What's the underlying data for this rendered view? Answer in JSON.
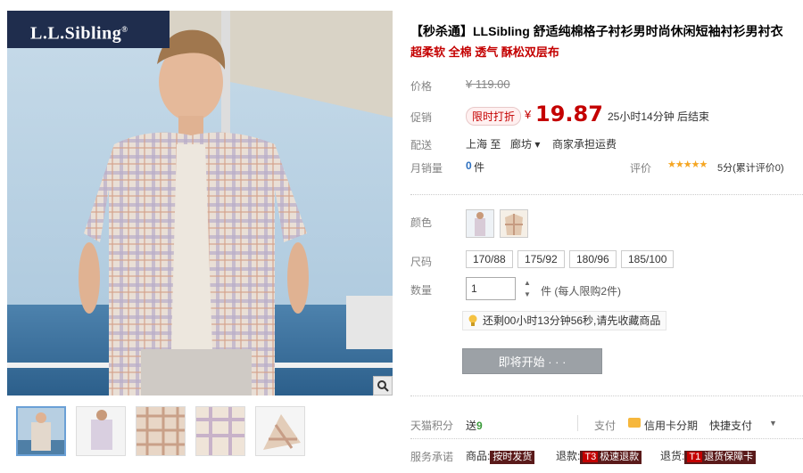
{
  "brand": {
    "logo_text": "L.L.Sibling",
    "reg_mark": "®"
  },
  "gallery": {
    "thumb_count": 5,
    "active_index": 0
  },
  "product": {
    "title": "【秒杀通】LLSibling 舒适纯棉格子衬衫男时尚休闲短袖衬衫男衬衣",
    "subtitle": "超柔软 全棉 透气 酥松双层布"
  },
  "price": {
    "label": "价格",
    "original": "¥ 119.00",
    "promo_label": "促销",
    "promo_tag": "限时打折",
    "currency": "¥",
    "current": "19.87",
    "countdown": "25小时14分钟 后结束"
  },
  "shipping": {
    "label": "配送",
    "from": "上海  至",
    "to": "廊坊 ▾",
    "fee": "商家承担运费"
  },
  "sales": {
    "label": "月销量",
    "count": "0",
    "unit": "件"
  },
  "rating": {
    "label": "评价",
    "stars": "★★★★★",
    "text": "5分(累计评价0)"
  },
  "color": {
    "label": "颜色"
  },
  "size": {
    "label": "尺码",
    "options": [
      "170/88",
      "175/92",
      "180/96",
      "185/100"
    ]
  },
  "quantity": {
    "label": "数量",
    "value": "1",
    "note": "件 (每人限购2件)"
  },
  "reminder": "还剩00小时13分钟56秒,请先收藏商品",
  "start_button": "即将开始 · · ·",
  "points": {
    "label": "天猫积分",
    "prefix": "送",
    "value": "9"
  },
  "payment": {
    "label": "支付",
    "installment": "信用卡分期",
    "quick": "快捷支付"
  },
  "service": {
    "label": "服务承诺",
    "item1_label": "商品:",
    "item1_badge": "按时发货",
    "item2_label": "退款:",
    "item2_tag": "T3",
    "item2_badge": "极速退款",
    "item3_label": "退货:",
    "item3_tag": "T1",
    "item3_badge": "退货保障卡"
  },
  "colors": {
    "price_red": "#c40000",
    "badge_navy": "#1f2d4d",
    "button_grey": "#9ca1a6"
  }
}
